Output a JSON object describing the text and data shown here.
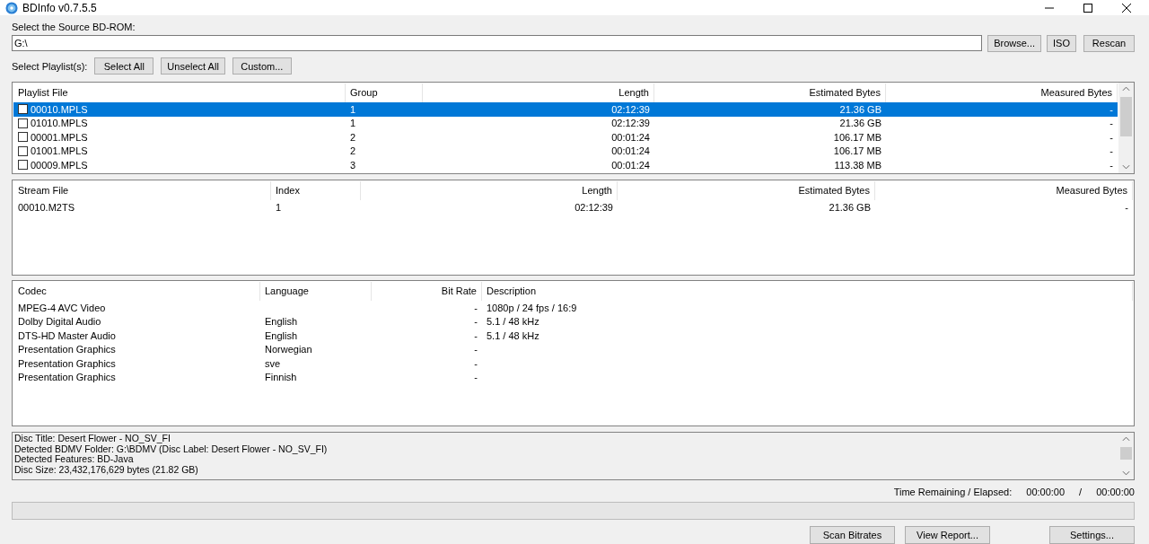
{
  "window": {
    "title": "BDInfo v0.7.5.5"
  },
  "source": {
    "label": "Select the Source BD-ROM:",
    "value": "G:\\",
    "buttons": [
      "Browse...",
      "ISO",
      "Rescan"
    ]
  },
  "playlist_select": {
    "label": "Select Playlist(s):",
    "buttons": [
      "Select All",
      "Unselect All",
      "Custom..."
    ]
  },
  "playlists": {
    "columns": [
      "Playlist File",
      "Group",
      "Length",
      "Estimated Bytes",
      "Measured Bytes"
    ],
    "rows": [
      {
        "cells": [
          "00010.MPLS",
          "1",
          "02:12:39",
          "21.36 GB",
          "-"
        ],
        "checked": false,
        "selected": true
      },
      {
        "cells": [
          "01010.MPLS",
          "1",
          "02:12:39",
          "21.36 GB",
          "-"
        ],
        "checked": false,
        "selected": false
      },
      {
        "cells": [
          "00001.MPLS",
          "2",
          "00:01:24",
          "106.17 MB",
          "-"
        ],
        "checked": false,
        "selected": false
      },
      {
        "cells": [
          "01001.MPLS",
          "2",
          "00:01:24",
          "106.17 MB",
          "-"
        ],
        "checked": false,
        "selected": false
      },
      {
        "cells": [
          "00009.MPLS",
          "3",
          "00:01:24",
          "113.38 MB",
          "-"
        ],
        "checked": false,
        "selected": false
      }
    ]
  },
  "stream_files": {
    "columns": [
      "Stream File",
      "Index",
      "Length",
      "Estimated Bytes",
      "Measured Bytes"
    ],
    "rows": [
      [
        "00010.M2TS",
        "1",
        "02:12:39",
        "21.36 GB",
        "-"
      ]
    ]
  },
  "streams": {
    "columns": [
      "Codec",
      "Language",
      "Bit Rate",
      "Description"
    ],
    "rows": [
      [
        "MPEG-4 AVC Video",
        "",
        "-",
        "1080p / 24 fps / 16:9"
      ],
      [
        "Dolby Digital Audio",
        "English",
        "-",
        "5.1 / 48 kHz"
      ],
      [
        "DTS-HD Master Audio",
        "English",
        "-",
        "5.1 / 48 kHz"
      ],
      [
        "Presentation Graphics",
        "Norwegian",
        "-",
        ""
      ],
      [
        "Presentation Graphics",
        "sve",
        "-",
        ""
      ],
      [
        "Presentation Graphics",
        "Finnish",
        "-",
        ""
      ]
    ]
  },
  "info_lines": [
    "Disc Title: Desert Flower - NO_SV_FI",
    "Detected BDMV Folder: G:\\BDMV (Disc Label: Desert Flower - NO_SV_FI)",
    "Detected Features: BD-Java",
    "Disc Size: 23,432,176,629 bytes (21.82 GB)"
  ],
  "time": {
    "label": "Time Remaining / Elapsed:",
    "remaining": "00:00:00",
    "separator": "/",
    "elapsed": "00:00:00"
  },
  "progress": {
    "level": 0
  },
  "bottom_buttons": [
    "Scan Bitrates",
    "View Report...",
    "Settings..."
  ]
}
